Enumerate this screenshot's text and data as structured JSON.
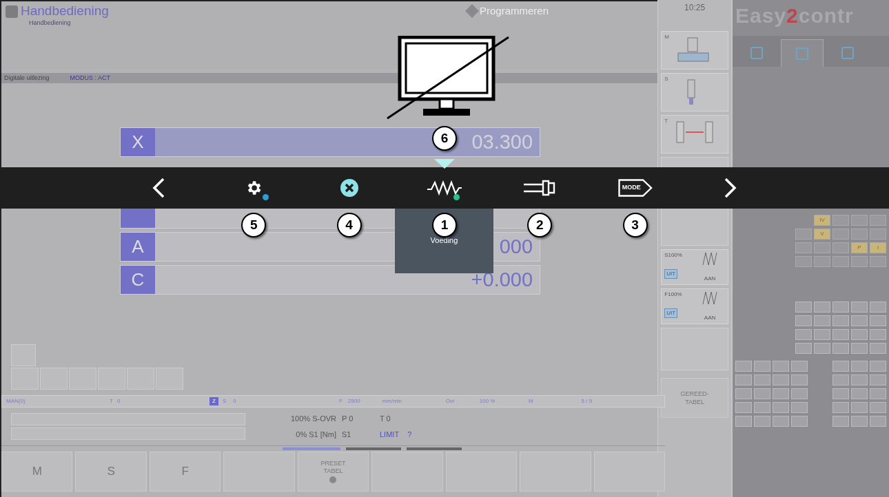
{
  "header": {
    "title": "Handbediening",
    "breadcrumb": "Handbediening",
    "mode_tab": "Programmeren"
  },
  "readout_bar": {
    "label": "Digitale uitlezing",
    "mode": "MODUS : ACT"
  },
  "axes": [
    {
      "name": "X",
      "value": "03.300",
      "selected": true
    },
    {
      "name": "A",
      "value": "000",
      "selected": false
    },
    {
      "name": "C",
      "value": "+0.000",
      "selected": false
    }
  ],
  "status_line": {
    "mode": "MAN(0)",
    "tool": [
      "T",
      "0"
    ],
    "badge": "Z",
    "spindle": [
      "S",
      "0"
    ],
    "feed": [
      "F",
      "2500",
      "mm/min"
    ],
    "override": [
      "Ovr",
      "100 %"
    ],
    "m_code": [
      "M",
      "5 / 5"
    ]
  },
  "info": [
    [
      {
        "text": "100% S-OVR",
        "kind": "plain"
      },
      {
        "text": "P 0",
        "kind": "plain"
      },
      {
        "text": "T 0",
        "kind": "plain"
      }
    ],
    [
      {
        "text": "0% S1 [Nm]",
        "kind": "plain"
      },
      {
        "text": "S1",
        "kind": "plain"
      },
      {
        "text": "LIMIT",
        "kind": "link"
      },
      {
        "text": "?",
        "kind": "link"
      }
    ]
  ],
  "softkeys": [
    {
      "kind": "text",
      "label": "M"
    },
    {
      "kind": "text",
      "label": "S"
    },
    {
      "kind": "text",
      "label": "F"
    },
    {
      "kind": "blank"
    },
    {
      "kind": "icon",
      "label": "PRESET TABEL"
    },
    {
      "kind": "blank"
    },
    {
      "kind": "blank"
    },
    {
      "kind": "blank"
    },
    {
      "kind": "blank"
    }
  ],
  "side_panel": {
    "time": "10:25",
    "tiles": [
      {
        "kind": "machine",
        "label": "M"
      },
      {
        "kind": "spindle",
        "label": "S"
      },
      {
        "kind": "tool",
        "label": "T"
      },
      {
        "kind": "blank"
      },
      {
        "kind": "blank"
      },
      {
        "kind": "override",
        "label": "S100%",
        "off": "UIT",
        "on": "AAN"
      },
      {
        "kind": "override",
        "label": "F100%",
        "off": "UIT",
        "on": "AAN"
      },
      {
        "kind": "blank"
      }
    ],
    "softkey": "GEREED-TABEL"
  },
  "logo": {
    "prefix": "Easy",
    "accent": "2",
    "suffix": "contr"
  },
  "panel_tabs": [
    {
      "selected": false
    },
    {
      "selected": true
    },
    {
      "selected": false
    }
  ],
  "keypad": [
    [
      {
        "kind": "gap"
      },
      {
        "kind": "key",
        "label": "IV",
        "highlighted": true
      },
      {
        "kind": "key",
        "highlighted": false
      },
      {
        "kind": "key",
        "highlighted": false
      },
      {
        "kind": "key",
        "highlighted": false
      }
    ],
    [
      {
        "kind": "key",
        "highlighted": false
      },
      {
        "kind": "key",
        "label": "V",
        "highlighted": true
      },
      {
        "kind": "key",
        "highlighted": false
      },
      {
        "kind": "key",
        "highlighted": false
      },
      {
        "kind": "key",
        "highlighted": false
      }
    ],
    [
      {
        "kind": "key",
        "highlighted": false
      },
      {
        "kind": "key",
        "highlighted": false
      },
      {
        "kind": "key",
        "highlighted": false
      },
      {
        "kind": "key",
        "label": "P",
        "highlighted": true
      },
      {
        "kind": "key",
        "label": "I",
        "highlighted": true
      }
    ],
    [
      {
        "kind": "key",
        "highlighted": false
      },
      {
        "kind": "key",
        "highlighted": false
      },
      {
        "kind": "key",
        "highlighted": false
      },
      {
        "kind": "key",
        "highlighted": false
      },
      {
        "kind": "key",
        "highlighted": false
      }
    ]
  ],
  "toolbar": [
    {
      "kind": "prev",
      "selected": false
    },
    {
      "kind": "settings",
      "color": "#2a9fd6",
      "callout": "5",
      "selected": false
    },
    {
      "kind": "close",
      "callout": "4",
      "selected": false
    },
    {
      "kind": "feed",
      "color": "#2fbf8f",
      "callout": "1",
      "callout_above": "6",
      "tooltip": "Voeding",
      "selected": true
    },
    {
      "kind": "plug",
      "callout": "2",
      "selected": false
    },
    {
      "kind": "mode",
      "label": "MODE",
      "callout": "3",
      "selected": false
    },
    {
      "kind": "next",
      "selected": false
    }
  ]
}
